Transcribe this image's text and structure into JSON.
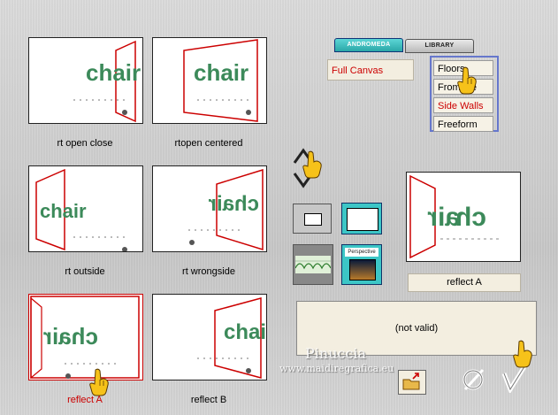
{
  "thumbnails": [
    {
      "caption": "rt open close",
      "selected": false
    },
    {
      "caption": "rtopen centered",
      "selected": false
    },
    {
      "caption": "rt outside",
      "selected": false
    },
    {
      "caption": "rt wrongside",
      "selected": false
    },
    {
      "caption": "reflect A",
      "selected": true
    },
    {
      "caption": "reflect B",
      "selected": false
    }
  ],
  "thumbnail_word": "chair",
  "tabs": {
    "andromeda": "ANDROMEDA",
    "library": "LIBRARY"
  },
  "full_canvas": "Full Canvas",
  "menu": {
    "items": [
      "Floors",
      "From the Top",
      "Side Walls",
      "Freeform"
    ],
    "selected_index": 2
  },
  "preview": {
    "label": "reflect A"
  },
  "status_text": "(not valid)",
  "watermark": {
    "name": "Pinuccia",
    "url": "www.maidiregrafica.eu"
  },
  "colors": {
    "accent": "#cc0000",
    "menu_border": "#6677cc",
    "teal": "#3cc6c6"
  },
  "icons": [
    "up-down-arrows-icon",
    "pointing-hand-icon",
    "open-file-icon",
    "cancel-icon",
    "ok-check-icon"
  ]
}
